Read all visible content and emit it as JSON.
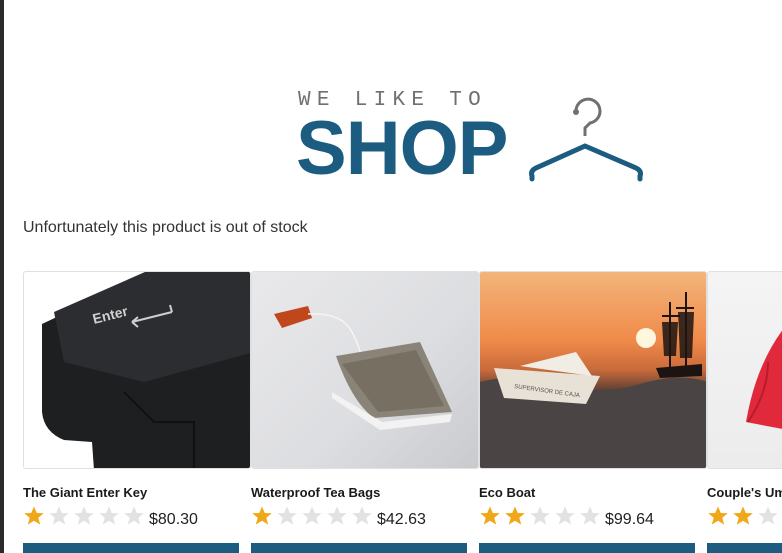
{
  "logo": {
    "top_text": "WE LIKE TO",
    "main_text": "SHOP"
  },
  "message": "Unfortunately this product is out of stock",
  "colors": {
    "brand": "#1b5c80",
    "star_filled": "#f0a81a",
    "star_empty": "#e2e2e2"
  },
  "products": [
    {
      "name": "The Giant Enter Key",
      "rating": 1,
      "max_rating": 5,
      "price": "$80.30",
      "image": "giant-enter-key"
    },
    {
      "name": "Waterproof Tea Bags",
      "rating": 1,
      "max_rating": 5,
      "price": "$42.63",
      "image": "tea-bag"
    },
    {
      "name": "Eco Boat",
      "rating": 2,
      "max_rating": 5,
      "price": "$99.64",
      "image": "paper-boat-sunset"
    },
    {
      "name": "Couple's Um",
      "rating": 2,
      "max_rating": 5,
      "price": "",
      "image": "red-umbrella"
    }
  ]
}
